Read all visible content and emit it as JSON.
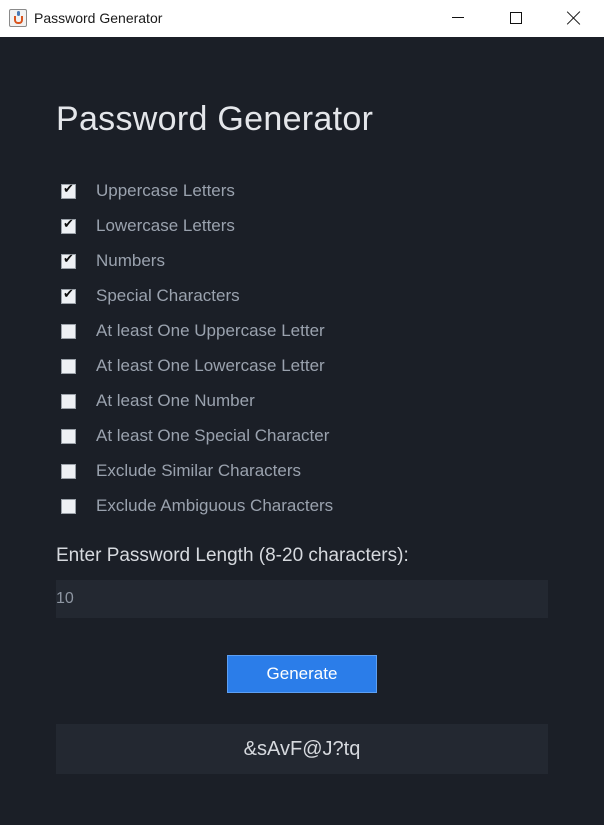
{
  "window": {
    "title": "Password Generator",
    "icon": "java-coffee-cup-icon"
  },
  "main": {
    "heading": "Password Generator",
    "options": [
      {
        "label": "Uppercase Letters",
        "checked": true
      },
      {
        "label": "Lowercase Letters",
        "checked": true
      },
      {
        "label": "Numbers",
        "checked": true
      },
      {
        "label": "Special Characters",
        "checked": true
      },
      {
        "label": "At least One Uppercase Letter",
        "checked": false
      },
      {
        "label": "At least One Lowercase Letter",
        "checked": false
      },
      {
        "label": "At least One Number",
        "checked": false
      },
      {
        "label": "At least One Special Character",
        "checked": false
      },
      {
        "label": "Exclude Similar Characters",
        "checked": false
      },
      {
        "label": "Exclude Ambiguous Characters",
        "checked": false
      }
    ],
    "length_label": "Enter Password Length (8-20 characters):",
    "length_value": "10",
    "generate_label": "Generate",
    "result": "&sAvF@J?tq"
  },
  "colors": {
    "background": "#1b1f27",
    "panel": "#232831",
    "accent": "#2b7de9",
    "heading_text": "#e4e6ea",
    "option_text": "#9aa2ae"
  }
}
